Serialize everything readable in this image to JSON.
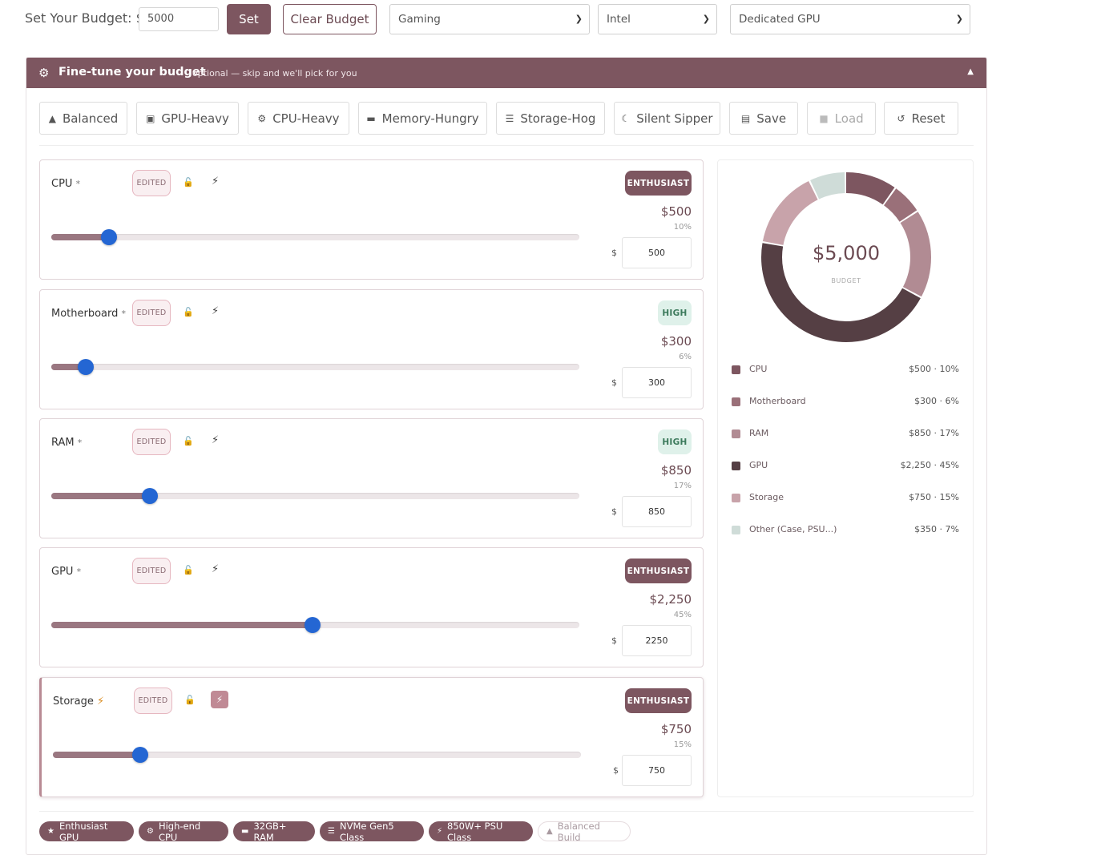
{
  "topbar": {
    "budget_label": "Set Your Budget: $",
    "budget_value": "5000",
    "set_label": "Set",
    "clear_label": "Clear Budget",
    "use_case": "Gaming",
    "cpu_brand": "Intel",
    "gpu_type": "Dedicated GPU"
  },
  "panel": {
    "title": "Fine-tune your budget",
    "subtitle": "optional — skip and we'll pick for you",
    "collapse_icon": "caret-up-icon",
    "presets": [
      {
        "label": "Balanced",
        "icon": "balance-icon"
      },
      {
        "label": "GPU-Heavy",
        "icon": "gpu-icon"
      },
      {
        "label": "CPU-Heavy",
        "icon": "cpu-chip-icon"
      },
      {
        "label": "Memory-Hungry",
        "icon": "memory-icon"
      },
      {
        "label": "Storage-Hog",
        "icon": "storage-icon"
      },
      {
        "label": "Silent Sipper",
        "icon": "moon-icon"
      },
      {
        "label": "Save",
        "icon": "save-icon"
      },
      {
        "label": "Load",
        "icon": "folder-icon",
        "disabled": true
      },
      {
        "label": "Reset",
        "icon": "reset-icon"
      }
    ]
  },
  "components": [
    {
      "name": "CPU",
      "required": "*",
      "edited": "EDITED",
      "tier": "ENTHUSIAST",
      "amount": "$500",
      "pct": "10%",
      "dollar": "$",
      "value": "500",
      "share": 0.1
    },
    {
      "name": "Motherboard",
      "required": "*",
      "edited": "EDITED",
      "tier": "HIGH",
      "amount": "$300",
      "pct": "6%",
      "dollar": "$",
      "value": "300",
      "share": 0.06
    },
    {
      "name": "RAM",
      "required": "*",
      "edited": "EDITED",
      "tier": "HIGH",
      "amount": "$850",
      "pct": "17%",
      "dollar": "$",
      "value": "850",
      "share": 0.17
    },
    {
      "name": "GPU",
      "required": "*",
      "edited": "EDITED",
      "tier": "ENTHUSIAST",
      "amount": "$2,250",
      "pct": "45%",
      "dollar": "$",
      "value": "2250",
      "share": 0.45
    },
    {
      "name": "Storage",
      "required": "",
      "edited": "EDITED",
      "tier": "ENTHUSIAST",
      "amount": "$750",
      "pct": "15%",
      "dollar": "$",
      "value": "750",
      "share": 0.15
    }
  ],
  "summary": {
    "total": "$5,000",
    "total_label": "BUDGET",
    "legend": [
      {
        "name": "CPU",
        "value": "$500 · 10%",
        "color": "#7d5660"
      },
      {
        "name": "Motherboard",
        "value": "$300 · 6%",
        "color": "#9a7079"
      },
      {
        "name": "RAM",
        "value": "$850 · 17%",
        "color": "#b18b93"
      },
      {
        "name": "GPU",
        "value": "$2,250 · 45%",
        "color": "#553f44"
      },
      {
        "name": "Storage",
        "value": "$750 · 15%",
        "color": "#c8a3aa"
      },
      {
        "name": "Other (Case, PSU...)",
        "value": "$350 · 7%",
        "color": "#cfdcd8"
      }
    ]
  },
  "badges": [
    {
      "label": "Enthusiast GPU",
      "icon": "trophy-icon"
    },
    {
      "label": "High-end CPU",
      "icon": "cpu-chip-icon"
    },
    {
      "label": "32GB+ RAM",
      "icon": "memory-icon"
    },
    {
      "label": "NVMe Gen5 Class",
      "icon": "storage-icon"
    },
    {
      "label": "850W+ PSU Class",
      "icon": "bolt-icon"
    },
    {
      "label": "Balanced Build",
      "icon": "balance-icon",
      "light": true
    }
  ]
}
